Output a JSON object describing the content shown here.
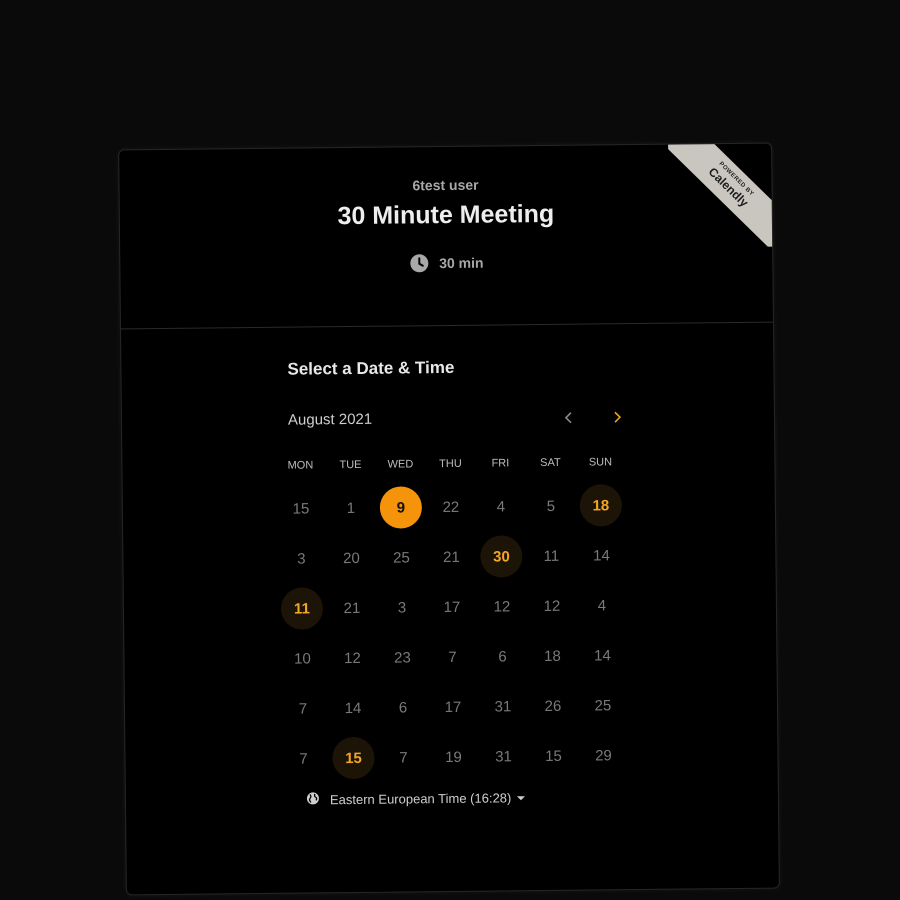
{
  "event": {
    "owner": "6test user",
    "title": "30 Minute Meeting",
    "duration": "30 min",
    "duration_icon": "clock-icon"
  },
  "badge": {
    "powered_by": "POWERED BY",
    "brand": "Calendly",
    "background": "#c9c6c0"
  },
  "scheduler": {
    "heading": "Select a Date & Time",
    "month": "August 2021",
    "prev_icon": "chevron-left-icon",
    "next_icon": "chevron-right-icon",
    "weekdays": [
      "MON",
      "TUE",
      "WED",
      "THU",
      "FRI",
      "SAT",
      "SUN"
    ],
    "days": [
      [
        "15",
        "1",
        "9",
        "22",
        "4",
        "5",
        "18"
      ],
      [
        "3",
        "20",
        "25",
        "21",
        "30",
        "11",
        "14"
      ],
      [
        "11",
        "21",
        "3",
        "17",
        "12",
        "12",
        "4"
      ],
      [
        "10",
        "12",
        "23",
        "7",
        "6",
        "18",
        "14"
      ],
      [
        "7",
        "14",
        "6",
        "17",
        "31",
        "26",
        "25"
      ],
      [
        "7",
        "15",
        "7",
        "19",
        "31",
        "15",
        "29"
      ]
    ],
    "day_states": [
      [
        "",
        "",
        "selected",
        "",
        "",
        "",
        "available"
      ],
      [
        "",
        "",
        "",
        "",
        "available",
        "",
        ""
      ],
      [
        "available",
        "",
        "",
        "",
        "",
        "",
        ""
      ],
      [
        "",
        "",
        "",
        "",
        "",
        "",
        ""
      ],
      [
        "",
        "",
        "",
        "",
        "",
        "",
        ""
      ],
      [
        "",
        "available",
        "",
        "",
        "",
        "",
        ""
      ]
    ],
    "timezone": "Eastern European Time (16:28)",
    "timezone_icon": "globe-icon"
  },
  "colors": {
    "accent": "#f5930a",
    "available_text": "#f5a623",
    "available_bg": "#1d1408",
    "background": "#000000"
  }
}
